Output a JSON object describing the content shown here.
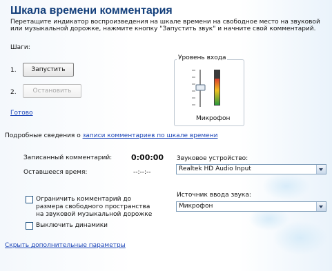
{
  "title": "Шкала времени комментария",
  "description": "Перетащите индикатор воспроизведения на шкале времени на свободное место на звуковой или музыкальной дорожке, нажмите кнопку \"Запустить звук\" и начните свой комментарий.",
  "steps": {
    "label": "Шаги:",
    "step1_num": "1.",
    "start_label": "Запустить",
    "step2_num": "2.",
    "stop_label": "Остановить",
    "done_link": "Готово"
  },
  "input_level": {
    "legend": "Уровень входа",
    "mic_label": "Микрофон",
    "meter_level": 0.8
  },
  "details": {
    "prefix": "Подробные сведения о ",
    "link": "записи комментариев по шкале времени"
  },
  "recorded": {
    "label": "Записанный комментарий:",
    "value": "0:00:00"
  },
  "remaining": {
    "label": "Оставшееся время:",
    "value": "--:--:--"
  },
  "audio_device": {
    "label": "Звуковое устройство:",
    "value": "Realtek HD Audio Input"
  },
  "input_source": {
    "label": "Источник ввода звука:",
    "value": "Микрофон"
  },
  "options": {
    "limit_label_1": "Ограничить комментарий до",
    "limit_label_2": "размера свободного пространства",
    "limit_label_3": "на звуковой музыкальной дорожке",
    "limit_checked": false,
    "mute_label": "Выключить динамики",
    "mute_checked": false
  },
  "hide_link": "Скрыть дополнительные параметры",
  "colors": {
    "title": "#123e7a",
    "link": "#1d46b8",
    "meter_top": "#d93b2b",
    "meter_mid": "#f0c020",
    "meter_bottom": "#2b9a3a"
  }
}
